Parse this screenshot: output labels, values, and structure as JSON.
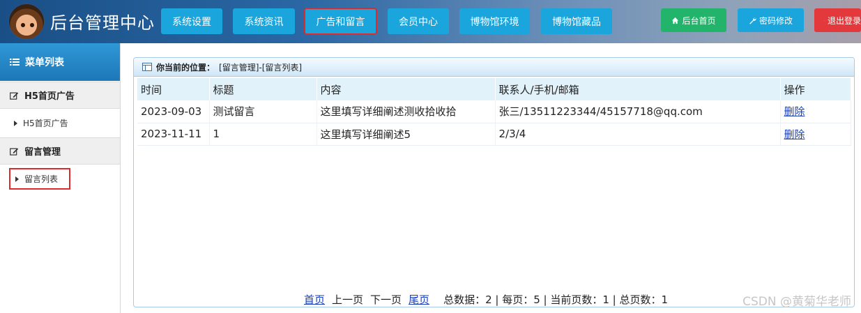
{
  "header": {
    "title": "后台管理中心",
    "nav": [
      "系统设置",
      "系统资讯",
      "广告和留言",
      "会员中心",
      "博物馆环境",
      "博物馆藏品"
    ],
    "actions": {
      "home": "后台首页",
      "password": "密码修改",
      "logout": "退出登录"
    }
  },
  "sidebar": {
    "menu_title": "菜单列表",
    "groups": [
      {
        "title": "H5首页广告",
        "item": "H5首页广告"
      },
      {
        "title": "留言管理",
        "item": "留言列表"
      }
    ]
  },
  "panel": {
    "location_label": "你当前的位置：",
    "breadcrumb": "[留言管理]-[留言列表]"
  },
  "table": {
    "columns": [
      "时间",
      "标题",
      "内容",
      "联系人/手机/邮箱",
      "操作"
    ],
    "rows": [
      {
        "time": "2023-09-03",
        "title": "测试留言",
        "content": "这里填写详细阐述测收拾收拾",
        "contact": "张三/13511223344/45157718@qq.com",
        "action": "删除"
      },
      {
        "time": "2023-11-11",
        "title": "1",
        "content": "这里填写详细阐述5",
        "contact": "2/3/4",
        "action": "删除"
      }
    ]
  },
  "pager": {
    "first": "首页",
    "prev": "上一页",
    "next": "下一页",
    "last": "尾页",
    "stats": "总数据：2 | 每页：5 | 当前页数：1 | 总页数：1"
  },
  "watermark": "CSDN @黄菊华老师"
}
